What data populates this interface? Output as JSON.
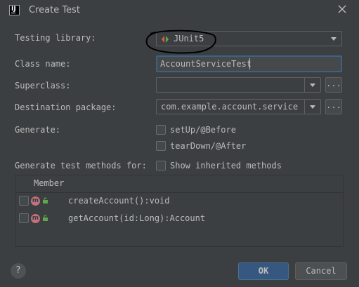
{
  "window": {
    "title": "Create Test",
    "app_icon_text": "IJ"
  },
  "form": {
    "testing_library": {
      "label": "Testing library:",
      "value": "JUnit5"
    },
    "class_name": {
      "label": "Class name:",
      "value": "AccountServiceTest"
    },
    "superclass": {
      "label": "Superclass:",
      "value": "",
      "browse": "..."
    },
    "destination_package": {
      "label": "Destination package:",
      "value": "com.example.account.service",
      "browse": "..."
    },
    "generate": {
      "label": "Generate:",
      "options": [
        {
          "label": "setUp/@Before",
          "checked": false
        },
        {
          "label": "tearDown/@After",
          "checked": false
        }
      ]
    },
    "methods_for": {
      "label": "Generate test methods for:",
      "show_inherited": {
        "label": "Show inherited methods",
        "checked": false
      }
    }
  },
  "members": {
    "header": "Member",
    "rows": [
      {
        "badge": "m",
        "name": "createAccount():void",
        "checked": false
      },
      {
        "badge": "m",
        "name": "getAccount(id:Long):Account",
        "checked": false
      }
    ]
  },
  "buttons": {
    "help": "?",
    "ok": "OK",
    "cancel": "Cancel"
  },
  "colors": {
    "background": "#3c3f41",
    "accent": "#365880",
    "focus": "#3d6185",
    "method_badge": "#c4717d"
  }
}
